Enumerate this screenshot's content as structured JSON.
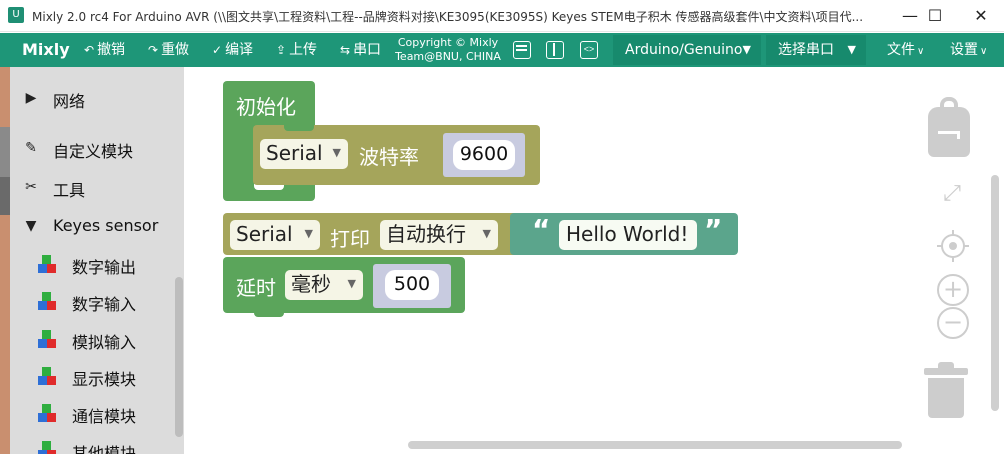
{
  "window": {
    "logo_text": "U",
    "title": "Mixly 2.0 rc4 For Arduino AVR (\\\\图文共享\\工程资料\\工程--品牌资料对接\\KE3095(KE3095S) Keyes STEM电子积木 传感器高级套件\\中文资料\\项目代...",
    "minimize": "—",
    "maximize": "☐",
    "close": "✕"
  },
  "toolbar": {
    "brand": "Mixly",
    "undo": "撤销",
    "redo": "重做",
    "compile": "编译",
    "upload": "上传",
    "serial": "串口",
    "copyright_line1": "Copyright © Mixly",
    "copyright_line2": "Team@BNU, CHINA",
    "board": "Arduino/Genuino",
    "port": "选择串口",
    "file": "文件",
    "settings": "设置",
    "accent_color": "#1e9678"
  },
  "sidebar": {
    "categories": [
      {
        "label": "网络",
        "icon": "triangle-right-icon"
      },
      {
        "label": "自定义模块",
        "icon": "pen-icon"
      },
      {
        "label": "工具",
        "icon": "tools-icon"
      },
      {
        "label": "Keyes sensor",
        "icon": "triangle-down-icon"
      },
      {
        "label": "数字输出",
        "icon": "cube-icon"
      },
      {
        "label": "数字输入",
        "icon": "cube-icon"
      },
      {
        "label": "模拟输入",
        "icon": "cube-icon"
      },
      {
        "label": "显示模块",
        "icon": "cube-icon"
      },
      {
        "label": "通信模块",
        "icon": "cube-icon"
      },
      {
        "label": "其他模块",
        "icon": "cube-icon"
      }
    ]
  },
  "blocks": {
    "setup": {
      "label": "初始化",
      "color": "#5ba55b"
    },
    "serial_begin": {
      "port": "Serial",
      "label": "波特率",
      "baud": "9600",
      "color": "#a5a55b"
    },
    "serial_print": {
      "port": "Serial",
      "label": "打印",
      "mode": "自动换行",
      "color": "#a5a55b"
    },
    "text": {
      "open_quote": "“",
      "value": "Hello World!",
      "close_quote": "”",
      "color": "#5ba58c"
    },
    "delay": {
      "label": "延时",
      "unit": "毫秒",
      "value": "500",
      "color": "#5ba55b"
    }
  },
  "workspace_controls": [
    "backpack-icon",
    "fullscreen-icon",
    "center-icon",
    "zoom-in-icon",
    "zoom-out-icon",
    "trash-icon"
  ]
}
